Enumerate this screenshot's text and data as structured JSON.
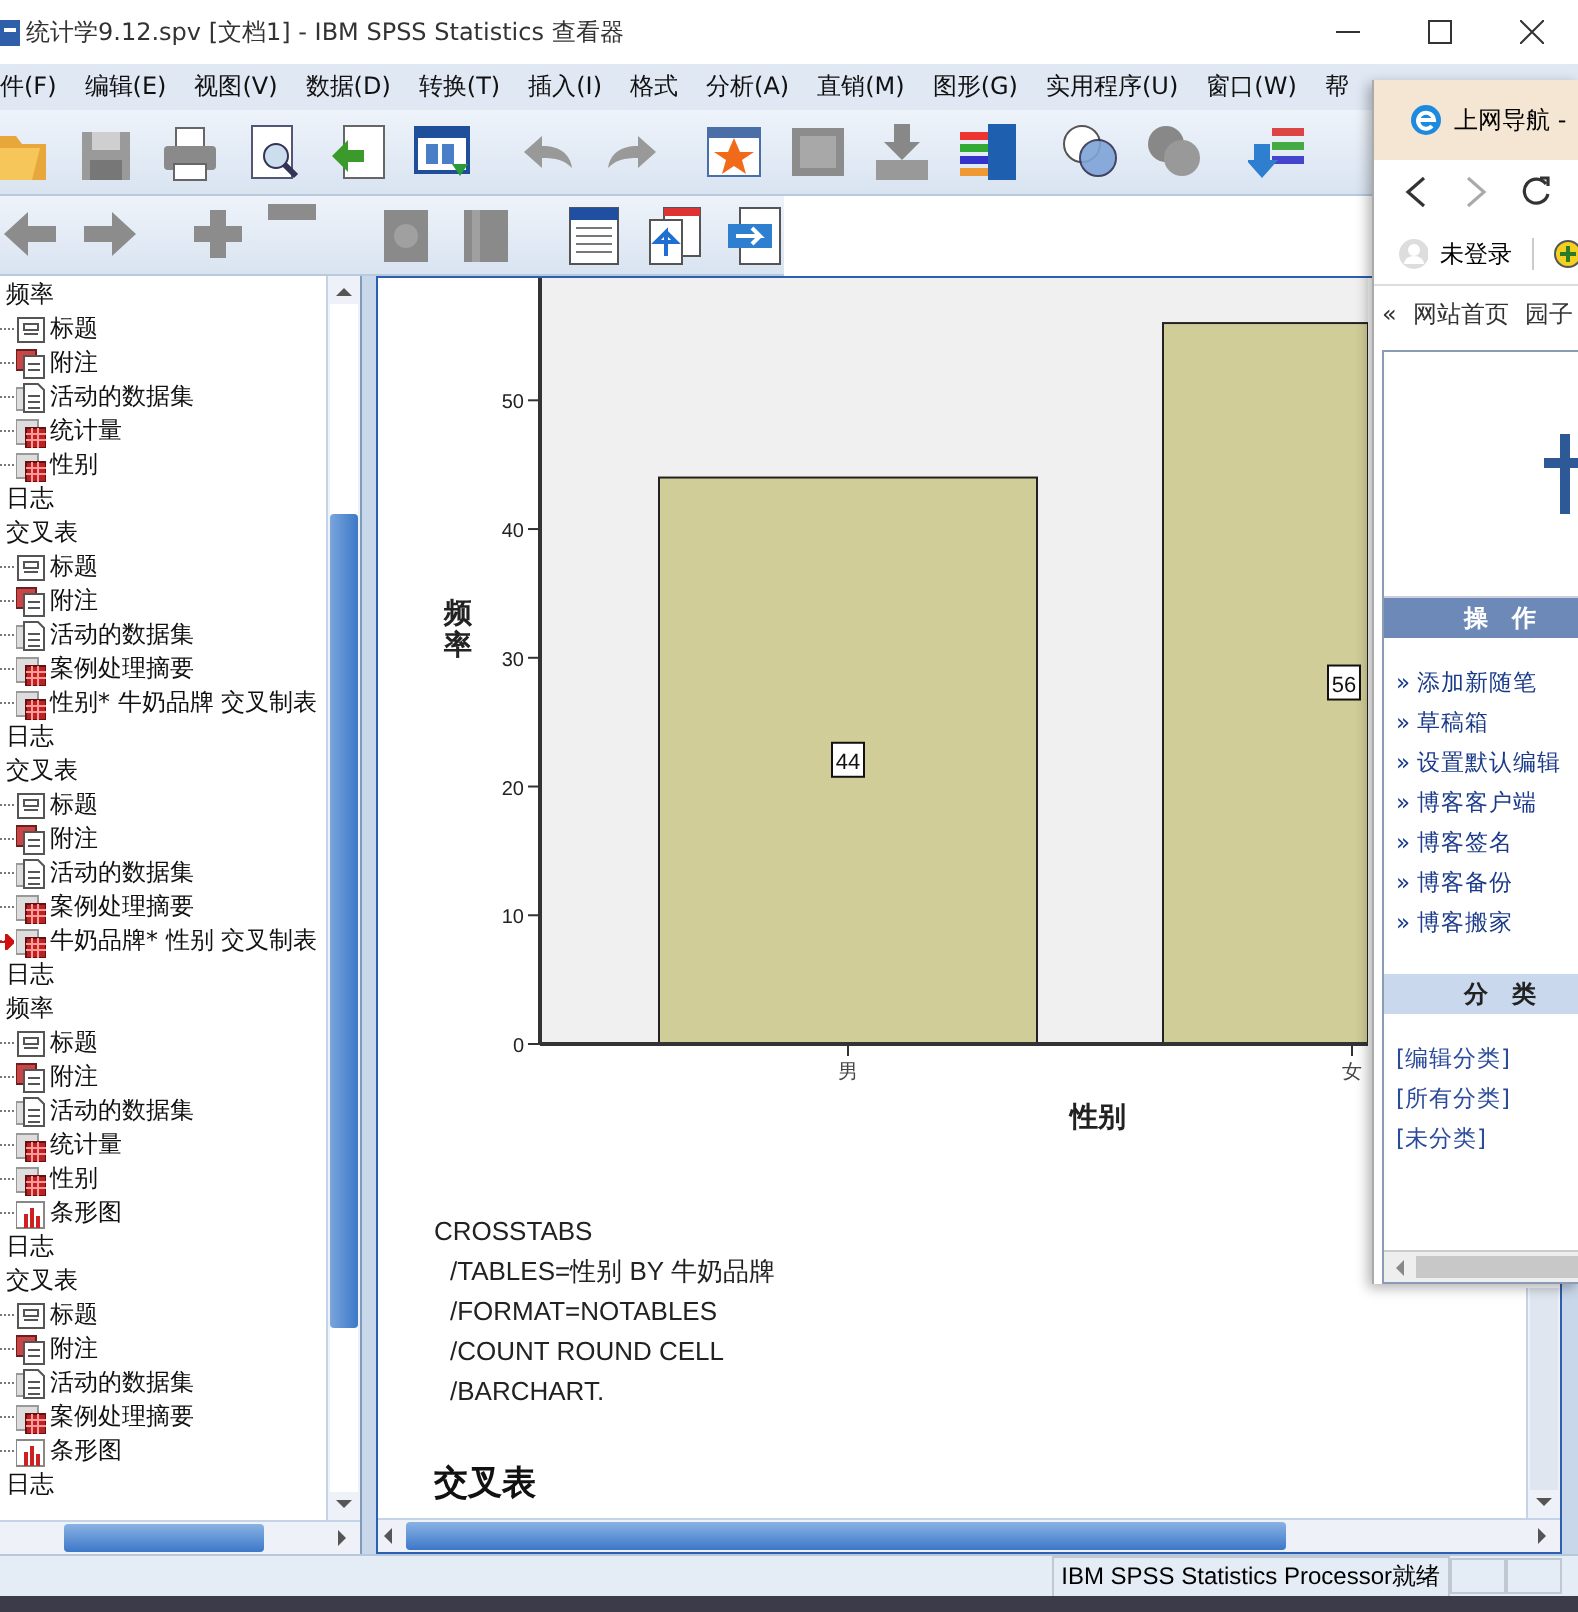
{
  "window": {
    "title": "统计学9.12.spv [文档1] - IBM SPSS Statistics 查看器"
  },
  "menu": [
    "件(F)",
    "编辑(E)",
    "视图(V)",
    "数据(D)",
    "转换(T)",
    "插入(I)",
    "格式",
    "分析(A)",
    "直销(M)",
    "图形(G)",
    "实用程序(U)",
    "窗口(W)",
    "帮"
  ],
  "outline": [
    {
      "label": "频率",
      "selected": false,
      "children": [
        {
          "label": "标题",
          "kind": "title",
          "selected": false
        },
        {
          "label": "附注",
          "kind": "notes",
          "selected": false
        },
        {
          "label": "活动的数据集",
          "kind": "dataset",
          "selected": false
        },
        {
          "label": "统计量",
          "kind": "table",
          "selected": false
        },
        {
          "label": "性别",
          "kind": "table",
          "selected": false
        }
      ]
    },
    {
      "label": "日志",
      "selected": false
    },
    {
      "label": "交叉表",
      "selected": false,
      "children": [
        {
          "label": "标题",
          "kind": "title",
          "selected": false
        },
        {
          "label": "附注",
          "kind": "notes",
          "selected": false
        },
        {
          "label": "活动的数据集",
          "kind": "dataset",
          "selected": false
        },
        {
          "label": "案例处理摘要",
          "kind": "table",
          "selected": false
        },
        {
          "label": "性别* 牛奶品牌 交叉制表",
          "kind": "table",
          "selected": false
        }
      ]
    },
    {
      "label": "日志",
      "selected": false
    },
    {
      "label": "交叉表",
      "selected": false,
      "children": [
        {
          "label": "标题",
          "kind": "title",
          "selected": false
        },
        {
          "label": "附注",
          "kind": "notes",
          "selected": false
        },
        {
          "label": "活动的数据集",
          "kind": "dataset",
          "selected": false
        },
        {
          "label": "案例处理摘要",
          "kind": "table",
          "selected": false
        },
        {
          "label": "牛奶品牌* 性别 交叉制表",
          "kind": "table",
          "selected": true
        }
      ]
    },
    {
      "label": "日志",
      "selected": false
    },
    {
      "label": "频率",
      "selected": false,
      "children": [
        {
          "label": "标题",
          "kind": "title",
          "selected": false
        },
        {
          "label": "附注",
          "kind": "notes",
          "selected": false
        },
        {
          "label": "活动的数据集",
          "kind": "dataset",
          "selected": false
        },
        {
          "label": "统计量",
          "kind": "table",
          "selected": false
        },
        {
          "label": "性别",
          "kind": "table",
          "selected": false
        },
        {
          "label": "条形图",
          "kind": "chart",
          "selected": false
        }
      ]
    },
    {
      "label": "日志",
      "selected": false
    },
    {
      "label": "交叉表",
      "selected": false,
      "children": [
        {
          "label": "标题",
          "kind": "title",
          "selected": false
        },
        {
          "label": "附注",
          "kind": "notes",
          "selected": false
        },
        {
          "label": "活动的数据集",
          "kind": "dataset",
          "selected": false
        },
        {
          "label": "案例处理摘要",
          "kind": "table",
          "selected": false
        },
        {
          "label": "条形图",
          "kind": "chart",
          "selected": false
        }
      ]
    },
    {
      "label": "日志",
      "selected": false
    }
  ],
  "chart": {
    "chart_data": {
      "type": "bar",
      "xlabel": "性别",
      "ylabel": "频率",
      "categories": [
        "男",
        "女"
      ],
      "values": [
        44,
        56
      ],
      "ylim": [
        0,
        59.5
      ],
      "yticks": [
        0,
        10,
        20,
        30,
        40,
        50
      ],
      "data_labels": true
    }
  },
  "syntax": [
    {
      "text": "CROSSTABS",
      "indented": false
    },
    {
      "text": "/TABLES=性别 BY 牛奶品牌",
      "indented": true
    },
    {
      "text": "/FORMAT=NOTABLES",
      "indented": true
    },
    {
      "text": "/COUNT ROUND CELL",
      "indented": true
    },
    {
      "text": "/BARCHART.",
      "indented": true
    }
  ],
  "section_heading": "交叉表",
  "status_bar": "IBM SPSS Statistics Processor就绪",
  "browser": {
    "tab_title": "上网导航 -",
    "login": "未登录",
    "bookmarks_chevron": "«",
    "bookmarks": [
      "网站首页",
      "园子"
    ],
    "sections": [
      {
        "title": "操　作",
        "kind": "dark",
        "links": [
          "» 添加新随笔",
          "» 草稿箱",
          "» 设置默认编辑",
          "» 博客客户端",
          "» 博客签名",
          "» 博客备份",
          "» 博客搬家"
        ]
      },
      {
        "title": "分　类",
        "kind": "light",
        "links": [
          "[编辑分类]",
          "[所有分类]",
          "[未分类]"
        ]
      }
    ]
  }
}
